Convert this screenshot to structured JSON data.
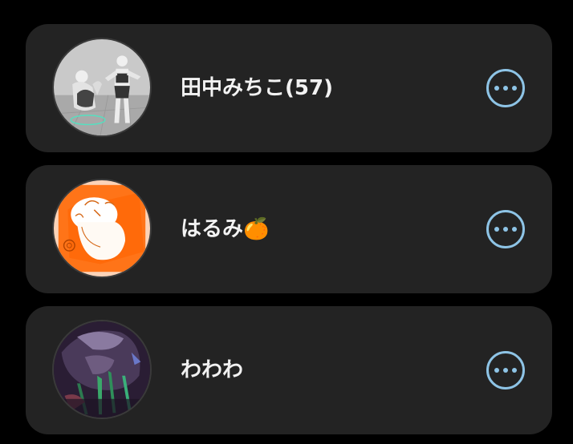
{
  "accent_color": "#8ec4e6",
  "card_background": "#232323",
  "page_background": "#000000",
  "contacts": [
    {
      "name": "田中みちこ(57)",
      "avatar_icon": "avatar-3d-figures",
      "more_icon": "more-options-icon"
    },
    {
      "name": "はるみ🍊",
      "avatar_icon": "avatar-orange-sketch",
      "more_icon": "more-options-icon"
    },
    {
      "name": "わわわ",
      "avatar_icon": "avatar-dark-illustration",
      "more_icon": "more-options-icon"
    }
  ]
}
